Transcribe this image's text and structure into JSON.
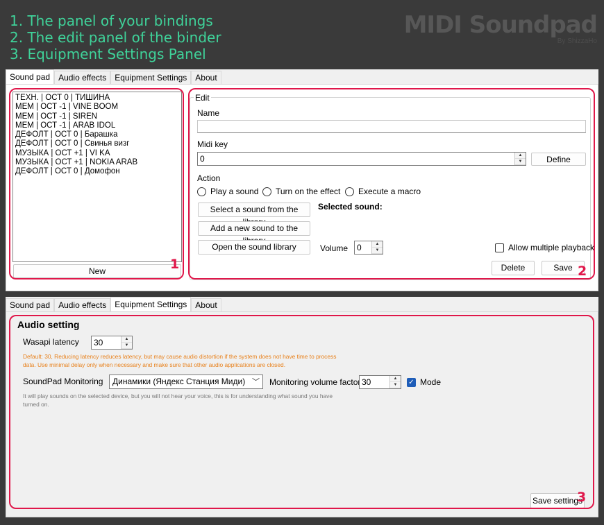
{
  "header": {
    "items": [
      "1. The panel of your bindings",
      "2. The edit panel of the binder",
      "3. Equipment Settings Panel"
    ],
    "brand": "MIDI Soundpad",
    "brand_sub": "By ShizzaHo"
  },
  "win1": {
    "tabs": [
      "Sound pad",
      "Audio effects",
      "Equipment Settings",
      "About"
    ],
    "bindings": [
      "ТЕХН. | ОСТ 0 | ТИШИНА",
      "МЕМ | ОСТ -1 | VINE BOOM",
      "МЕМ | ОСТ -1 | SIREN",
      "МЕМ | ОСТ -1 | ARAB IDOL",
      "ДЕФОЛТ | ОСТ 0 | Барашка",
      "ДЕФОЛТ | ОСТ 0 | Свинья визг",
      "МУЗЫКА | ОСТ +1 | VI KA",
      "МУЗЫКА | ОСТ +1 | NOKIA ARAB",
      "ДЕФОЛТ | ОСТ 0 | Домофон"
    ],
    "new_label": "New",
    "edit": {
      "group_title": "Edit",
      "name_label": "Name",
      "name_value": "",
      "midi_label": "Midi key",
      "midi_value": "0",
      "define_label": "Define",
      "action_label": "Action",
      "radio_play": "Play a sound",
      "radio_effect": "Turn on the effect",
      "radio_macro": "Execute a macro",
      "select_sound": "Select a sound from the library",
      "selected_sound": "Selected sound:",
      "add_sound": "Add a new sound to the library",
      "open_library": "Open the sound library",
      "volume_label": "Volume",
      "volume_value": "0",
      "allow_multiple": "Allow multiple playback",
      "delete_label": "Delete",
      "save_label": "Save"
    },
    "marker1": "1",
    "marker2": "2"
  },
  "win2": {
    "tabs": [
      "Sound pad",
      "Audio effects",
      "Equipment Settings",
      "About"
    ],
    "title": "Audio setting",
    "wasapi_label": "Wasapi latency",
    "wasapi_value": "30",
    "wasapi_hint": "Default: 30, Reducing latency reduces latency, but may cause audio distortion if the system does not have time to process data. Use minimal delay only when necessary and make sure that other audio applications are closed.",
    "monitoring_label": "SoundPad Monitoring",
    "monitoring_device": "Динамики (Яндекс Станция Миди)",
    "monitor_volume_label": "Monitoring volume factor",
    "monitor_volume_value": "30",
    "mode_label": "Mode",
    "monitoring_hint": "It will play sounds on the selected device, but you will not hear your voice, this is for understanding what sound you have turned on.",
    "save_settings": "Save settings",
    "marker3": "3"
  },
  "colors": {
    "accent": "#e0174a",
    "header_text": "#3fd39a",
    "hint_orange": "#e8801a"
  }
}
